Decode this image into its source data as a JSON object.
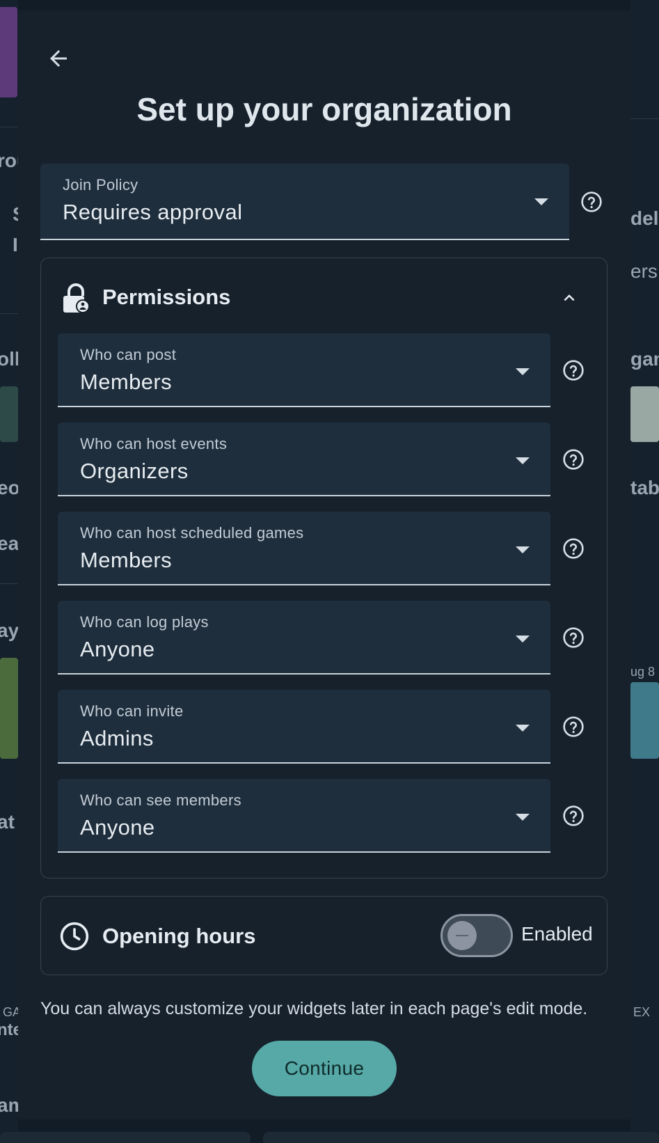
{
  "dialog": {
    "title": "Set up your organization",
    "join_policy": {
      "label": "Join Policy",
      "value": "Requires approval"
    },
    "permissions": {
      "title": "Permissions",
      "fields": [
        {
          "label": "Who can post",
          "value": "Members"
        },
        {
          "label": "Who can host events",
          "value": "Organizers"
        },
        {
          "label": "Who can host scheduled games",
          "value": "Members"
        },
        {
          "label": "Who can log plays",
          "value": "Anyone"
        },
        {
          "label": "Who can invite",
          "value": "Admins"
        },
        {
          "label": "Who can see members",
          "value": "Anyone"
        }
      ]
    },
    "opening_hours": {
      "title": "Opening hours",
      "toggle_label": "Enabled"
    },
    "hint": "You can always customize your widgets later in each page's edit mode.",
    "continue_label": "Continue"
  },
  "background": {
    "left_fragments": [
      "rou",
      "S",
      "I",
      "olle",
      "eo",
      "ea",
      "ay",
      "at",
      "GA",
      "nte",
      "am"
    ],
    "right_fragments": [
      "del",
      "ers",
      "gam",
      "tab",
      "ug 8",
      "EX"
    ]
  },
  "colors": {
    "accent": "#56a9a6",
    "surface": "#16212c",
    "field": "#1f2e3c"
  }
}
